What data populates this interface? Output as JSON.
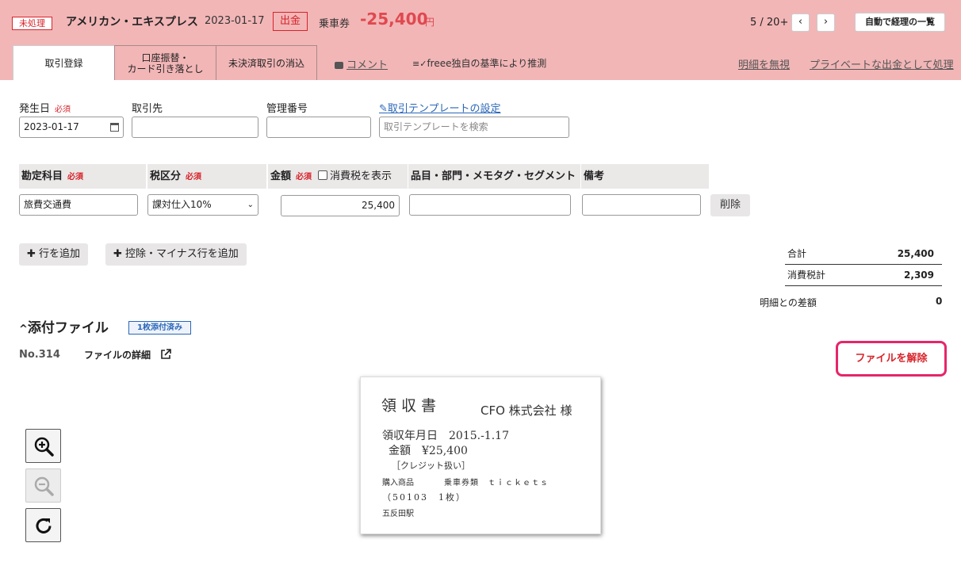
{
  "header": {
    "status": "未処理",
    "vendor": "アメリカン・エキスプレス",
    "date": "2023-01-17",
    "type": "出金",
    "item": "乗車券",
    "amount": "-25,400",
    "yen": "円",
    "pager": "5 / 20+",
    "prev": "‹",
    "next": "›",
    "auto_button": "自動で経理の一覧"
  },
  "tabs": [
    {
      "label": "取引登録"
    },
    {
      "label": "口座振替・\nカード引き落とし"
    },
    {
      "label": "未決済取引の消込"
    }
  ],
  "links": {
    "comment": "コメント",
    "estimate": "freee独自の基準により推測",
    "ignore": "明細を無視",
    "private": "プライベートな出金として処理"
  },
  "form": {
    "date_label": "発生日",
    "required": "必須",
    "date_value": "2023-01-17",
    "partner_label": "取引先",
    "mgmt_label": "管理番号",
    "template_link": "取引テンプレートの設定",
    "template_placeholder": "取引テンプレートを検索"
  },
  "table": {
    "headers": {
      "account": "勘定科目",
      "tax": "税区分",
      "amount": "金額",
      "show_tax": "消費税を表示",
      "tags": "品目・部門・メモタグ・セグメント",
      "note": "備考"
    },
    "row": {
      "account": "旅費交通費",
      "tax": "課対仕入10%",
      "amount": "25,400",
      "delete": "削除"
    }
  },
  "buttons": {
    "add_row": "行を追加",
    "add_minus_row": "控除・マイナス行を追加"
  },
  "summary": {
    "total_label": "合計",
    "total_value": "25,400",
    "tax_label": "消費税計",
    "tax_value": "2,309",
    "diff_label": "明細との差額",
    "diff_value": "0"
  },
  "attachment": {
    "title": "添付ファイル",
    "badge": "1枚添付済み",
    "file_no": "No.314",
    "detail": "ファイルの詳細",
    "unlink": "ファイルを解除"
  },
  "receipt": {
    "title": "領収書",
    "to": "CFO 株式会社 様",
    "date": "領収年月日　2015.-1.17",
    "amount": "金額　¥25,400",
    "credit": "［クレジット扱い］",
    "goods": "購入商品",
    "goods_value": "乗車券類　ｔｉｃｋｅｔｓ",
    "count": "（50103　1枚）",
    "station": "五反田駅"
  }
}
